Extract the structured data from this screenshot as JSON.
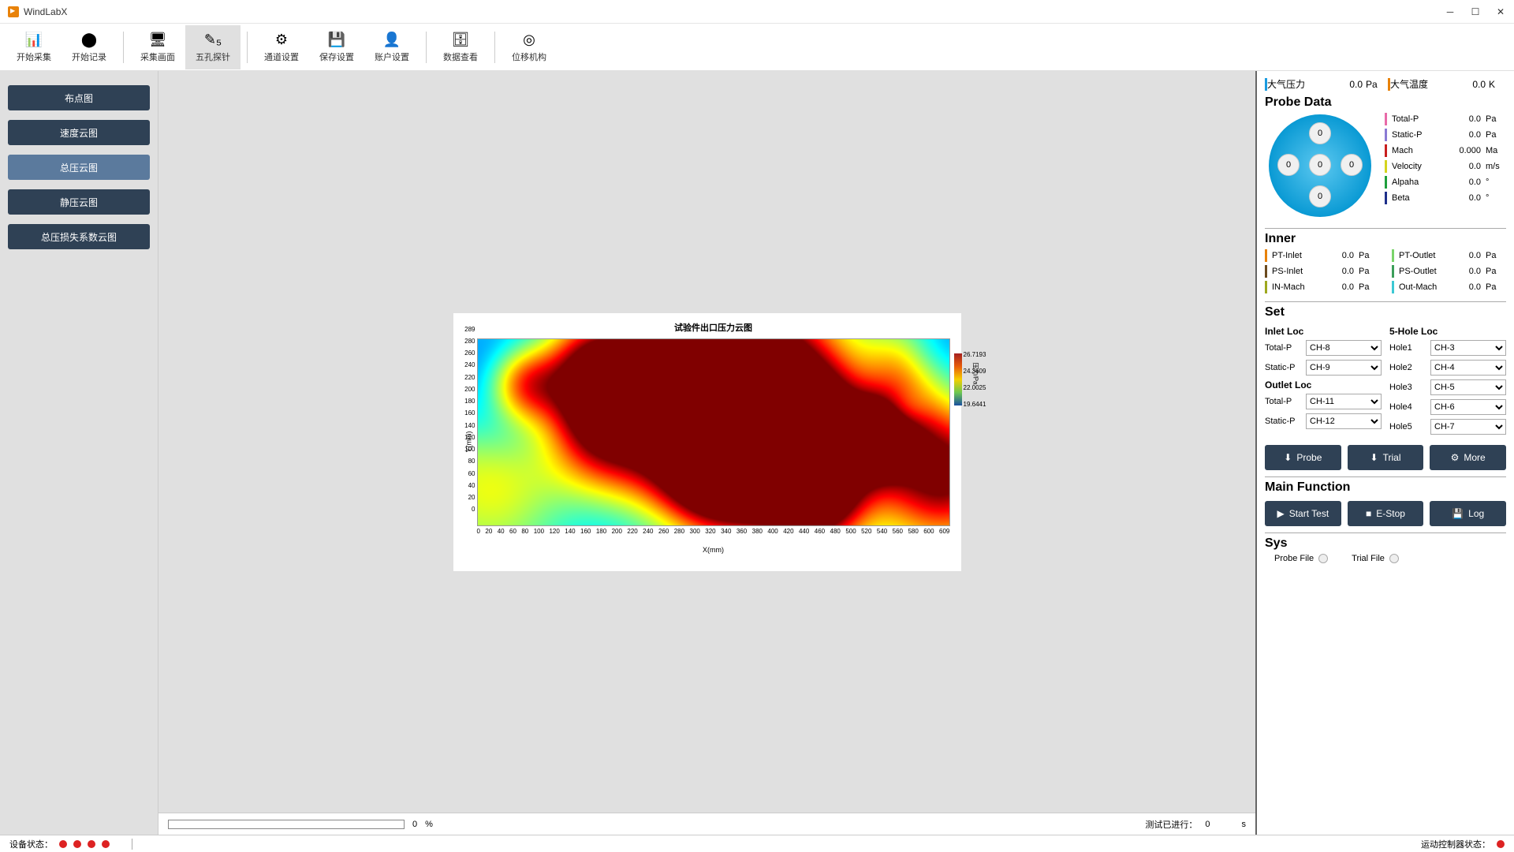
{
  "app": {
    "title": "WindLabX"
  },
  "toolbar": [
    {
      "label": "开始采集",
      "icon": "📊"
    },
    {
      "label": "开始记录",
      "icon": "⬤"
    },
    {
      "label": "采集画面",
      "icon": "🖥"
    },
    {
      "label": "五孔探针",
      "icon": "✎₅",
      "active": true
    },
    {
      "label": "通道设置",
      "icon": "⚙"
    },
    {
      "label": "保存设置",
      "icon": "💾"
    },
    {
      "label": "账户设置",
      "icon": "👤",
      "disabled": true
    },
    {
      "label": "数据查看",
      "icon": "🗄"
    },
    {
      "label": "位移机构",
      "icon": "◎"
    }
  ],
  "sidebar": [
    {
      "label": "布点图"
    },
    {
      "label": "速度云图"
    },
    {
      "label": "总压云图",
      "selected": true
    },
    {
      "label": "静压云图"
    },
    {
      "label": "总压损失系数云图"
    }
  ],
  "plot": {
    "title": "试验件出口压力云图",
    "xlabel": "X(mm)",
    "ylabel": "Y(mm)",
    "xticks": [
      "0",
      "20",
      "40",
      "60",
      "80",
      "100",
      "120",
      "140",
      "160",
      "180",
      "200",
      "220",
      "240",
      "260",
      "280",
      "300",
      "320",
      "340",
      "360",
      "380",
      "400",
      "420",
      "440",
      "460",
      "480",
      "500",
      "520",
      "540",
      "560",
      "580",
      "600",
      "609"
    ],
    "yticks": [
      "289",
      "280",
      "260",
      "240",
      "220",
      "200",
      "180",
      "160",
      "140",
      "120",
      "100",
      "80",
      "60",
      "40",
      "20",
      "0"
    ],
    "colorbar": {
      "label": "压力/Pa",
      "ticks": [
        "26.7193",
        "24.3609",
        "22.0025",
        "19.6441"
      ]
    }
  },
  "progress": {
    "pct": "0",
    "pct_unit": "%",
    "elapsed_label": "测试已进行：",
    "elapsed": "0",
    "elapsed_unit": "s"
  },
  "env": {
    "pressure": {
      "label": "大气压力",
      "value": "0.0",
      "unit": "Pa",
      "color": "#1a9be0"
    },
    "temp": {
      "label": "大气温度",
      "value": "0.0",
      "unit": "K",
      "color": "#e8820a"
    }
  },
  "probe": {
    "title": "Probe Data",
    "holes": [
      "0",
      "0",
      "0",
      "0",
      "0"
    ],
    "items": [
      {
        "label": "Total-P",
        "value": "0.0",
        "unit": "Pa",
        "color": "#e86aa8"
      },
      {
        "label": "Static-P",
        "value": "0.0",
        "unit": "Pa",
        "color": "#8a7ad4"
      },
      {
        "label": "Mach",
        "value": "0.000",
        "unit": "Ma",
        "color": "#c81e1e"
      },
      {
        "label": "Velocity",
        "value": "0.0",
        "unit": "m/s",
        "color": "#d4d41e"
      },
      {
        "label": "Alpaha",
        "value": "0.0",
        "unit": "°",
        "color": "#1e9e3c"
      },
      {
        "label": "Beta",
        "value": "0.0",
        "unit": "°",
        "color": "#1e2f8a"
      }
    ]
  },
  "inner": {
    "title": "Inner",
    "left": [
      {
        "label": "PT-Inlet",
        "value": "0.0",
        "unit": "Pa",
        "color": "#e8820a"
      },
      {
        "label": "PS-Inlet",
        "value": "0.0",
        "unit": "Pa",
        "color": "#6b4a1e"
      },
      {
        "label": "IN-Mach",
        "value": "0.0",
        "unit": "Pa",
        "color": "#9ea81e"
      }
    ],
    "right": [
      {
        "label": "PT-Outlet",
        "value": "0.0",
        "unit": "Pa",
        "color": "#7ad46a"
      },
      {
        "label": "PS-Outlet",
        "value": "0.0",
        "unit": "Pa",
        "color": "#3c9e5a"
      },
      {
        "label": "Out-Mach",
        "value": "0.0",
        "unit": "Pa",
        "color": "#3cc8d4"
      }
    ]
  },
  "set": {
    "title": "Set",
    "inlet": {
      "title": "Inlet Loc",
      "rows": [
        {
          "label": "Total-P",
          "value": "CH-8"
        },
        {
          "label": "Static-P",
          "value": "CH-9"
        }
      ]
    },
    "outlet": {
      "title": "Outlet Loc",
      "rows": [
        {
          "label": "Total-P",
          "value": "CH-11"
        },
        {
          "label": "Static-P",
          "value": "CH-12"
        }
      ]
    },
    "fivehole": {
      "title": "5-Hole Loc",
      "rows": [
        {
          "label": "Hole1",
          "value": "CH-3"
        },
        {
          "label": "Hole2",
          "value": "CH-4"
        },
        {
          "label": "Hole3",
          "value": "CH-5"
        },
        {
          "label": "Hole4",
          "value": "CH-6"
        },
        {
          "label": "Hole5",
          "value": "CH-7"
        }
      ]
    },
    "buttons": {
      "probe": "Probe",
      "trial": "Trial",
      "more": "More"
    }
  },
  "mainfn": {
    "title": "Main Function",
    "start": "Start Test",
    "estop": "E-Stop",
    "log": "Log"
  },
  "sys": {
    "title": "Sys",
    "probefile": "Probe File",
    "trialfile": "Trial File"
  },
  "status": {
    "device": "设备状态：",
    "motion": "运动控制器状态："
  },
  "chart_data": {
    "type": "heatmap",
    "title": "试验件出口压力云图",
    "xlabel": "X(mm)",
    "ylabel": "Y(mm)",
    "xlim": [
      0,
      609
    ],
    "ylim": [
      0,
      289
    ],
    "zlim": [
      19.6441,
      26.7193
    ],
    "colorbar_ticks": [
      26.7193,
      24.3609,
      22.0025,
      19.6441
    ],
    "colormap": "jet",
    "note": "2D pressure contour at specimen outlet; continuous field, individual cell values not readable from image"
  }
}
